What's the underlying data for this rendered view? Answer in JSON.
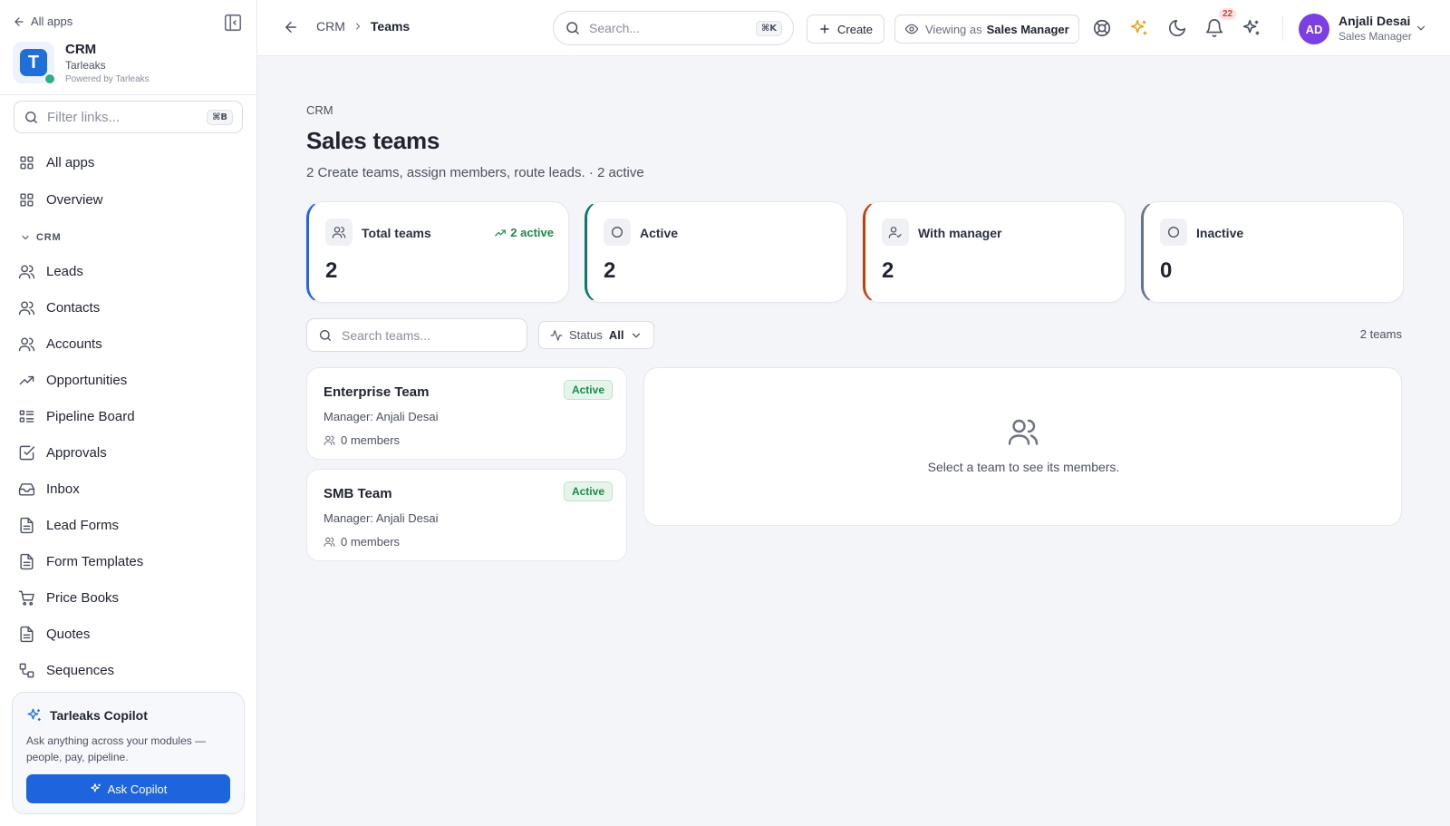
{
  "sidebar": {
    "back_label": "All apps",
    "brand": {
      "logo_letter": "T",
      "name": "CRM",
      "org": "Tarleaks",
      "powered": "Powered by Tarleaks"
    },
    "filter": {
      "placeholder": "Filter links...",
      "shortcut": "⌘B"
    },
    "top_items": [
      {
        "label": "All apps",
        "icon": "grid-icon"
      },
      {
        "label": "Overview",
        "icon": "grid-icon"
      }
    ],
    "section_label": "CRM",
    "items": [
      {
        "label": "Leads",
        "icon": "users-icon"
      },
      {
        "label": "Contacts",
        "icon": "users-icon"
      },
      {
        "label": "Accounts",
        "icon": "users-icon"
      },
      {
        "label": "Opportunities",
        "icon": "trending-up-icon"
      },
      {
        "label": "Pipeline Board",
        "icon": "list-icon"
      },
      {
        "label": "Approvals",
        "icon": "check-square-icon"
      },
      {
        "label": "Inbox",
        "icon": "inbox-icon"
      },
      {
        "label": "Lead Forms",
        "icon": "file-icon"
      },
      {
        "label": "Form Templates",
        "icon": "file-icon"
      },
      {
        "label": "Price Books",
        "icon": "cart-icon"
      },
      {
        "label": "Quotes",
        "icon": "file-icon"
      },
      {
        "label": "Sequences",
        "icon": "workflow-icon"
      }
    ],
    "copilot": {
      "title": "Tarleaks Copilot",
      "description": "Ask anything across your modules — people, pay, pipeline.",
      "button": "Ask Copilot"
    }
  },
  "topbar": {
    "breadcrumb": [
      "CRM",
      "Teams"
    ],
    "search": {
      "placeholder": "Search...",
      "shortcut": "⌘K"
    },
    "create_label": "Create",
    "viewing": {
      "label": "Viewing as",
      "value": "Sales Manager"
    },
    "notifications_count": "22",
    "user": {
      "initials": "AD",
      "name": "Anjali Desai",
      "role": "Sales Manager"
    },
    "colors": {
      "avatar": "#7b3fe4",
      "accent": "#1e64dc"
    }
  },
  "main": {
    "eyebrow": "CRM",
    "title": "Sales teams",
    "subtitle": "2 Create teams, assign members, route leads. · 2 active",
    "stats": [
      {
        "label": "Total teams",
        "value": "2",
        "trend": "2 active",
        "icon": "users-icon",
        "accent": "#2563eb"
      },
      {
        "label": "Active",
        "value": "2",
        "icon": "circle-icon",
        "accent": "#0f766e"
      },
      {
        "label": "With manager",
        "value": "2",
        "icon": "user-check-icon",
        "accent": "#c2410c"
      },
      {
        "label": "Inactive",
        "value": "0",
        "icon": "circle-icon",
        "accent": "#64748b"
      }
    ],
    "team_search_placeholder": "Search teams...",
    "status_filter": {
      "label": "Status",
      "value": "All"
    },
    "count_label": "2 teams",
    "teams": [
      {
        "name": "Enterprise Team",
        "status": "Active",
        "manager": "Manager: Anjali Desai",
        "members": "0 members"
      },
      {
        "name": "SMB Team",
        "status": "Active",
        "manager": "Manager: Anjali Desai",
        "members": "0 members"
      }
    ],
    "empty_state": "Select a team to see its members."
  }
}
